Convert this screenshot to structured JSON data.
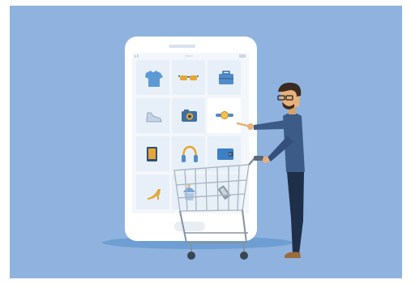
{
  "scene": {
    "background_color": "#8fb3de",
    "phone_color": "#ffffff",
    "tile_color": "#e7eff8",
    "accent_color": "#3c7ec0",
    "phone_status": {
      "left_glyph": "signal-wifi-icon",
      "center_text": "",
      "right_glyph": "battery-icon"
    },
    "products": [
      {
        "name": "t-shirt-icon"
      },
      {
        "name": "sunglasses-icon"
      },
      {
        "name": "briefcase-icon"
      },
      {
        "name": "sneaker-icon"
      },
      {
        "name": "camera-icon"
      },
      {
        "name": "wristwatch-icon"
      },
      {
        "name": "tablet-icon"
      },
      {
        "name": "headphones-icon"
      },
      {
        "name": "wallet-icon"
      },
      {
        "name": "high-heel-icon"
      },
      {
        "name": "cupcake-icon"
      },
      {
        "name": "phone-icon"
      }
    ],
    "figures": [
      "shopping-cart-icon",
      "shopper-man-figure"
    ]
  }
}
